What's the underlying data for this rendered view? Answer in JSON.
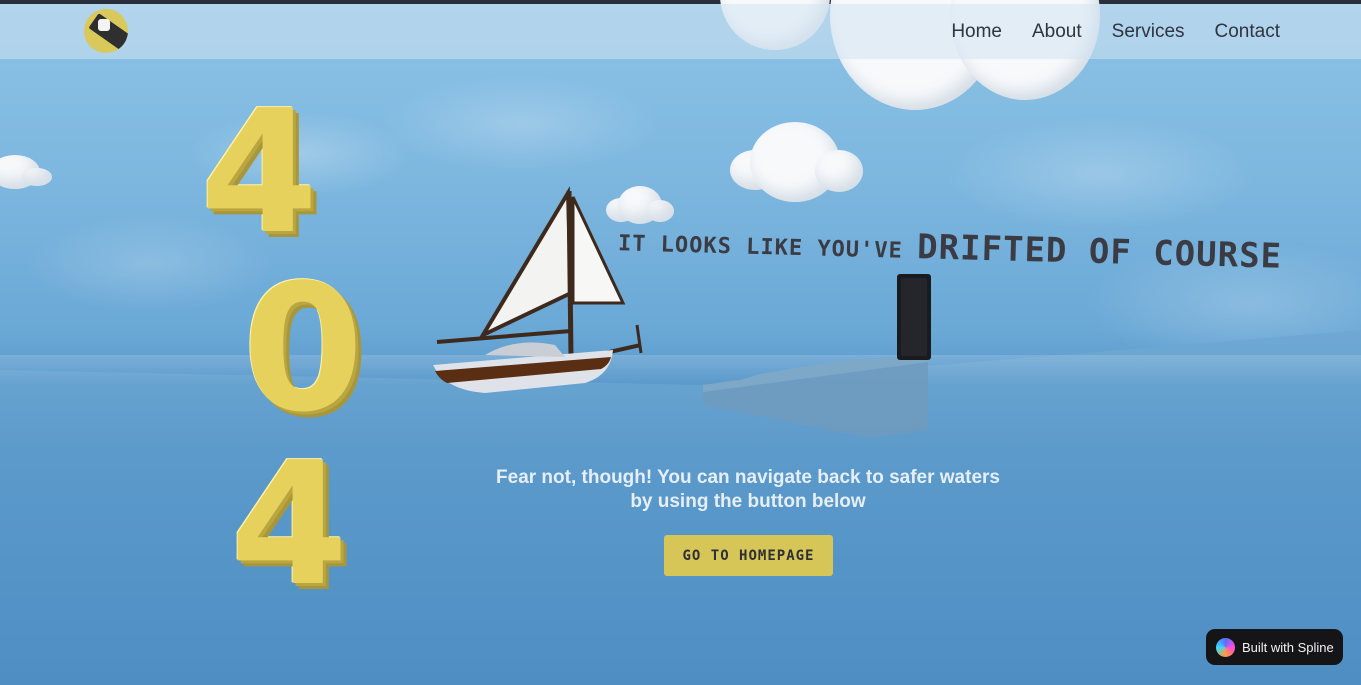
{
  "nav": {
    "logo_icon": "ship-logo-icon",
    "links": [
      {
        "label": "Home"
      },
      {
        "label": "About"
      },
      {
        "label": "Services"
      },
      {
        "label": "Contact"
      }
    ]
  },
  "hero": {
    "digits": [
      "4",
      "0",
      "4"
    ],
    "headline_prefix": "IT LOOKS LIKE YOU'VE ",
    "headline_main": "DRIFTED OF COURSE",
    "subtext": "Fear not, though! You can navigate back to safer waters by using the button below",
    "button_label": "GO TO HOMEPAGE"
  },
  "badge": {
    "label": "Built with Spline",
    "icon": "spline-logo-icon"
  },
  "colors": {
    "accent": "#d6c657",
    "digit": "#e6d15c",
    "sky": "#7db7df",
    "sea": "#5c9acb"
  }
}
